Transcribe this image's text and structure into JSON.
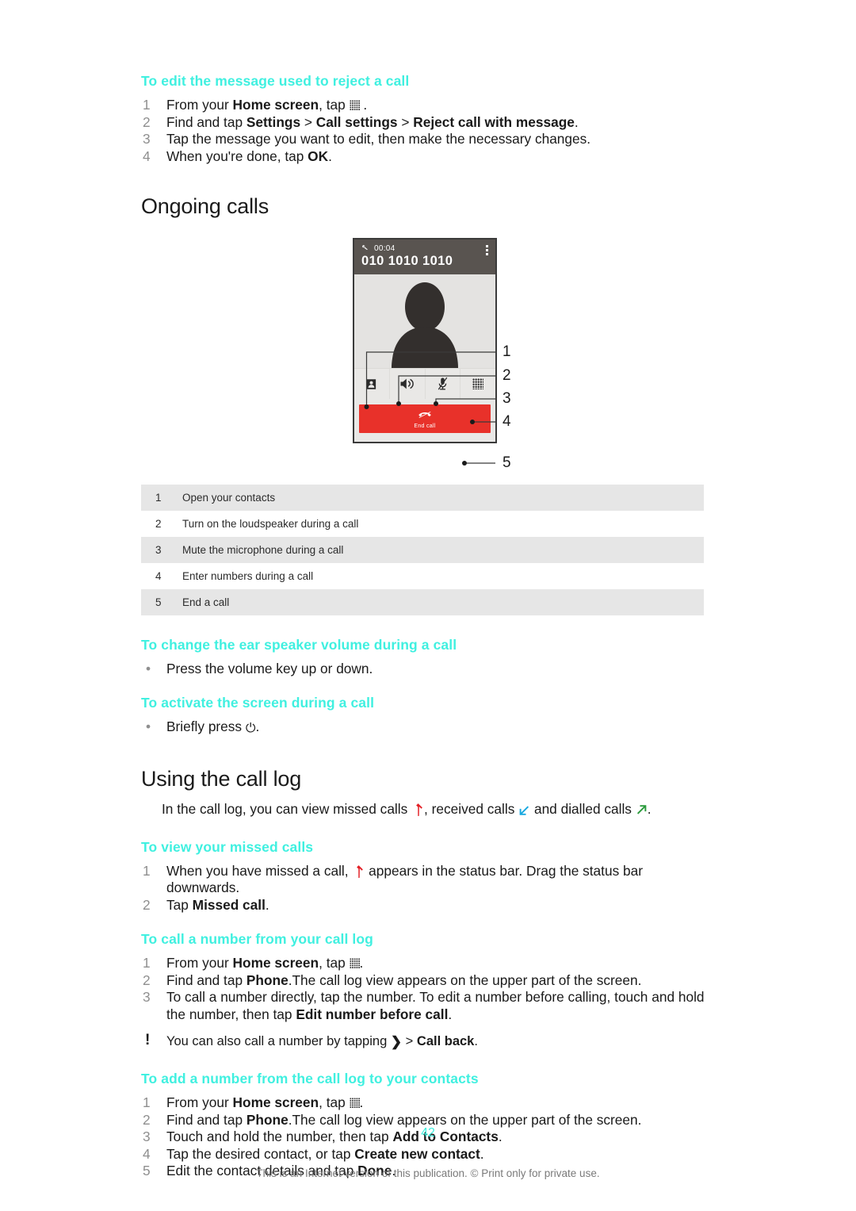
{
  "sections": {
    "reject_message": {
      "heading": "To edit the message used to reject a call",
      "steps": [
        {
          "num": "1",
          "pre": "From your ",
          "bold1": "Home screen",
          "mid": ", tap ",
          "icon": "app-grid-icon",
          "post": " ."
        },
        {
          "num": "2",
          "pre": "Find and tap ",
          "bold1": "Settings",
          "sep1": " > ",
          "bold2": "Call settings",
          "sep2": " > ",
          "bold3": "Reject call with message",
          "post": "."
        },
        {
          "num": "3",
          "text": "Tap the message you want to edit, then make the necessary changes."
        },
        {
          "num": "4",
          "pre": "When you're done, tap ",
          "bold1": "OK",
          "post": "."
        }
      ]
    },
    "ongoing_calls": {
      "title": "Ongoing calls",
      "phone": {
        "call_timer": "00:04",
        "phone_number": "010 1010 1010",
        "end_call_label": "End call",
        "status_icon": "phone-handset-icon",
        "overflow_icon": "kebab-menu-icon",
        "action_icons": [
          "contacts-icon",
          "loudspeaker-icon",
          "mute-microphone-icon",
          "dialpad-icon"
        ],
        "end_call_icon": "end-call-handset-icon",
        "callout_numbers": [
          "1",
          "2",
          "3",
          "4",
          "5"
        ]
      },
      "legend_rows": [
        {
          "num": "1",
          "desc": "Open your contacts"
        },
        {
          "num": "2",
          "desc": "Turn on the loudspeaker during a call"
        },
        {
          "num": "3",
          "desc": "Mute the microphone during a call"
        },
        {
          "num": "4",
          "desc": "Enter numbers during a call"
        },
        {
          "num": "5",
          "desc": "End a call"
        }
      ]
    },
    "ear_speaker_volume": {
      "heading": "To change the ear speaker volume during a call",
      "bullets": [
        {
          "text": "Press the volume key up or down."
        }
      ]
    },
    "activate_screen": {
      "heading": "To activate the screen during a call",
      "bullets": [
        {
          "pre": "Briefly press ",
          "icon": "power-icon",
          "post": "."
        }
      ]
    },
    "call_log": {
      "title": "Using the call log",
      "intro": {
        "p1": "In the call log, you can view missed calls ",
        "icon1": "missed-call-icon",
        "p2": ", received calls ",
        "icon2": "received-call-icon",
        "p3": " and dialled calls ",
        "icon3": "dialled-call-icon",
        "p4": "."
      }
    },
    "missed_calls": {
      "heading": "To view your missed calls",
      "steps": [
        {
          "num": "1",
          "pre": "When you have missed a call, ",
          "icon": "missed-call-icon",
          "post": " appears in the status bar. Drag the status bar downwards."
        },
        {
          "num": "2",
          "pre": "Tap ",
          "bold1": "Missed call",
          "post": "."
        }
      ]
    },
    "call_from_log": {
      "heading": "To call a number from your call log",
      "steps": [
        {
          "num": "1",
          "pre": "From your ",
          "bold1": "Home screen",
          "mid": ", tap ",
          "icon": "app-grid-icon",
          "post": "."
        },
        {
          "num": "2",
          "pre": "Find and tap ",
          "bold1": "Phone",
          "post": ".The call log view appears on the upper part of the screen."
        },
        {
          "num": "3",
          "pre": "To call a number directly, tap the number. To edit a number before calling, touch and hold the number, then tap ",
          "bold1": "Edit number before call",
          "post": "."
        }
      ],
      "tip": {
        "pre": "You can also call a number by tapping ",
        "icon": "chevron-right-icon",
        "mid": " > ",
        "bold1": "Call back",
        "post": "."
      }
    },
    "add_from_log": {
      "heading": "To add a number from the call log to your contacts",
      "steps": [
        {
          "num": "1",
          "pre": "From your ",
          "bold1": "Home screen",
          "mid": ", tap ",
          "icon": "app-grid-icon",
          "post": "."
        },
        {
          "num": "2",
          "pre": "Find and tap ",
          "bold1": "Phone",
          "post": ".The call log view appears on the upper part of the screen."
        },
        {
          "num": "3",
          "pre": "Touch and hold the number, then tap ",
          "bold1": "Add to Contacts",
          "post": "."
        },
        {
          "num": "4",
          "pre": "Tap the desired contact, or tap ",
          "bold1": "Create new contact",
          "post": "."
        },
        {
          "num": "5",
          "pre": "Edit the contact details and tap ",
          "bold1": "Done",
          "post": "."
        }
      ]
    }
  },
  "footer": {
    "page_number": "42",
    "note": "This is an Internet version of this publication. © Print only for private use."
  },
  "colors": {
    "heading_teal": "#40f0e0",
    "missed_call_red": "#e31e24",
    "received_call_blue": "#18a8e0",
    "dialled_call_green": "#2a9a3c",
    "end_call_red": "#e8312a",
    "phone_topbar": "#595450",
    "table_shade": "#e6e6e6"
  }
}
